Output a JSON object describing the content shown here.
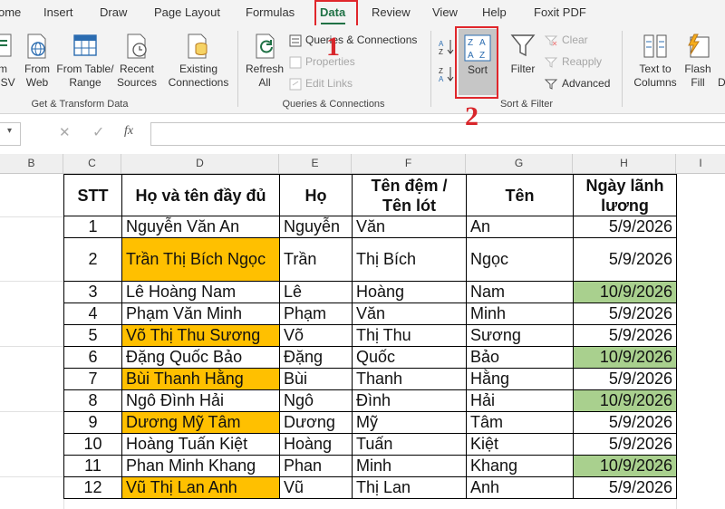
{
  "menu": {
    "tabs": [
      "ome",
      "Insert",
      "Draw",
      "Page Layout",
      "Formulas",
      "Data",
      "Review",
      "View",
      "Help",
      "Foxit PDF"
    ],
    "active": "Data"
  },
  "ribbon": {
    "get_transform": {
      "buttons": [
        {
          "line1": "m",
          "line2": "CSV"
        },
        {
          "line1": "From",
          "line2": "Web"
        },
        {
          "line1": "From Table/",
          "line2": "Range"
        },
        {
          "line1": "Recent",
          "line2": "Sources"
        },
        {
          "line1": "Existing",
          "line2": "Connections"
        }
      ],
      "group_label": "Get & Transform Data"
    },
    "queries": {
      "refresh_line1": "Refresh",
      "refresh_line2": "All",
      "items": [
        "Queries & Connections",
        "Properties",
        "Edit Links"
      ],
      "group_label": "Queries & Connections"
    },
    "sort_filter": {
      "sort_label": "Sort",
      "filter_label": "Filter",
      "items": [
        "Clear",
        "Reapply",
        "Advanced"
      ],
      "group_label": "Sort & Filter"
    },
    "data_tools": {
      "buttons": [
        {
          "line1": "Text to",
          "line2": "Columns"
        },
        {
          "line1": "Flash",
          "line2": "Fill"
        },
        {
          "line1": "D",
          "line2": ""
        }
      ]
    }
  },
  "formula_bar": {
    "namebox_value": "",
    "fx_label": "fx",
    "content": ""
  },
  "columns": [
    "B",
    "C",
    "D",
    "E",
    "F",
    "G",
    "H",
    "I"
  ],
  "table": {
    "headers": [
      "STT",
      "Họ và tên đầy đủ",
      "Họ",
      "Tên đệm /\nTên lót",
      "Tên",
      "Ngày lãnh\nlương"
    ],
    "rows": [
      {
        "stt": "1",
        "full": "Nguyễn Văn An",
        "ho": "Nguyễn",
        "dem": "Văn",
        "ten": "An",
        "date": "5/9/2026"
      },
      {
        "stt": "2",
        "full": "Trần Thị Bích Ngọc",
        "ho": "Trần",
        "dem": "Thị Bích",
        "ten": "Ngọc",
        "date": "5/9/2026"
      },
      {
        "stt": "3",
        "full": "Lê Hoàng Nam",
        "ho": "Lê",
        "dem": "Hoàng",
        "ten": "Nam",
        "date": "10/9/2026"
      },
      {
        "stt": "4",
        "full": "Phạm Văn Minh",
        "ho": "Phạm",
        "dem": "Văn",
        "ten": "Minh",
        "date": "5/9/2026"
      },
      {
        "stt": "5",
        "full": "Võ Thị Thu Sương",
        "ho": "Võ",
        "dem": "Thị Thu",
        "ten": "Sương",
        "date": "5/9/2026"
      },
      {
        "stt": "6",
        "full": "Đặng Quốc Bảo",
        "ho": "Đặng",
        "dem": "Quốc",
        "ten": "Bảo",
        "date": "10/9/2026"
      },
      {
        "stt": "7",
        "full": "Bùi Thanh Hằng",
        "ho": "Bùi",
        "dem": "Thanh",
        "ten": "Hằng",
        "date": "5/9/2026"
      },
      {
        "stt": "8",
        "full": "Ngô Đình Hải",
        "ho": "Ngô",
        "dem": "Đình",
        "ten": "Hải",
        "date": "10/9/2026"
      },
      {
        "stt": "9",
        "full": "Dương Mỹ Tâm",
        "ho": "Dương",
        "dem": "Mỹ",
        "ten": "Tâm",
        "date": "5/9/2026"
      },
      {
        "stt": "10",
        "full": "Hoàng Tuấn Kiệt",
        "ho": "Hoàng",
        "dem": "Tuấn",
        "ten": "Kiệt",
        "date": "5/9/2026"
      },
      {
        "stt": "11",
        "full": "Phan Minh Khang",
        "ho": "Phan",
        "dem": "Minh",
        "ten": "Khang",
        "date": "10/9/2026"
      },
      {
        "stt": "12",
        "full": "Vũ Thị Lan Anh",
        "ho": "Vũ",
        "dem": "Thị Lan",
        "ten": "Anh",
        "date": "5/9/2026"
      }
    ]
  },
  "annotations": {
    "step1": "1",
    "step2": "2"
  },
  "colors": {
    "accent_green": "#1f7145",
    "highlight_orange": "#ffc000",
    "highlight_green": "#a9d08e",
    "annotation_red": "#e0262b"
  },
  "icons": [
    "excel-icon",
    "web-icon",
    "table-icon",
    "clock-icon",
    "connections-icon",
    "refresh-icon",
    "sort-asc-icon",
    "sort-desc-icon",
    "sort-icon",
    "filter-icon",
    "clear-filter-icon",
    "reapply-icon",
    "advanced-filter-icon",
    "text-to-columns-icon",
    "flash-fill-icon"
  ]
}
